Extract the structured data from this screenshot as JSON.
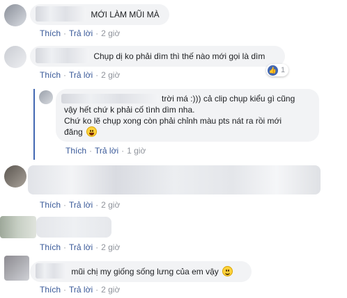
{
  "labels": {
    "like": "Thích",
    "reply": "Trả lời"
  },
  "comments": [
    {
      "text": "MỚI LÀM MŨI MÀ",
      "time": "2 giờ"
    },
    {
      "text": "Chụp dị ko phải dìm thì thế nào mới gọi là dìm",
      "time": "2 giờ",
      "reaction_count": "1"
    },
    {
      "text_line1": "trời má :))) cả clip chụp kiểu gì cũng",
      "text_line2": "vậy hết chứ k phải cố tình dìm nha.",
      "text_line3": "Chứ ko lẽ chụp xong còn phải chỉnh màu pts nát ra rồi mới",
      "text_line4": "đăng",
      "time": "1 giờ",
      "emoji": "laughing-face"
    },
    {
      "time": "2 giờ"
    },
    {
      "time": "2 giờ"
    },
    {
      "text": "mũi chị my giống sống lưng của em vậy",
      "time": "2 giờ",
      "emoji": "smiling-face"
    }
  ],
  "colors": {
    "link": "#385898",
    "muted": "#90949c",
    "bubble": "#f2f3f5",
    "like": "#4267b2"
  }
}
